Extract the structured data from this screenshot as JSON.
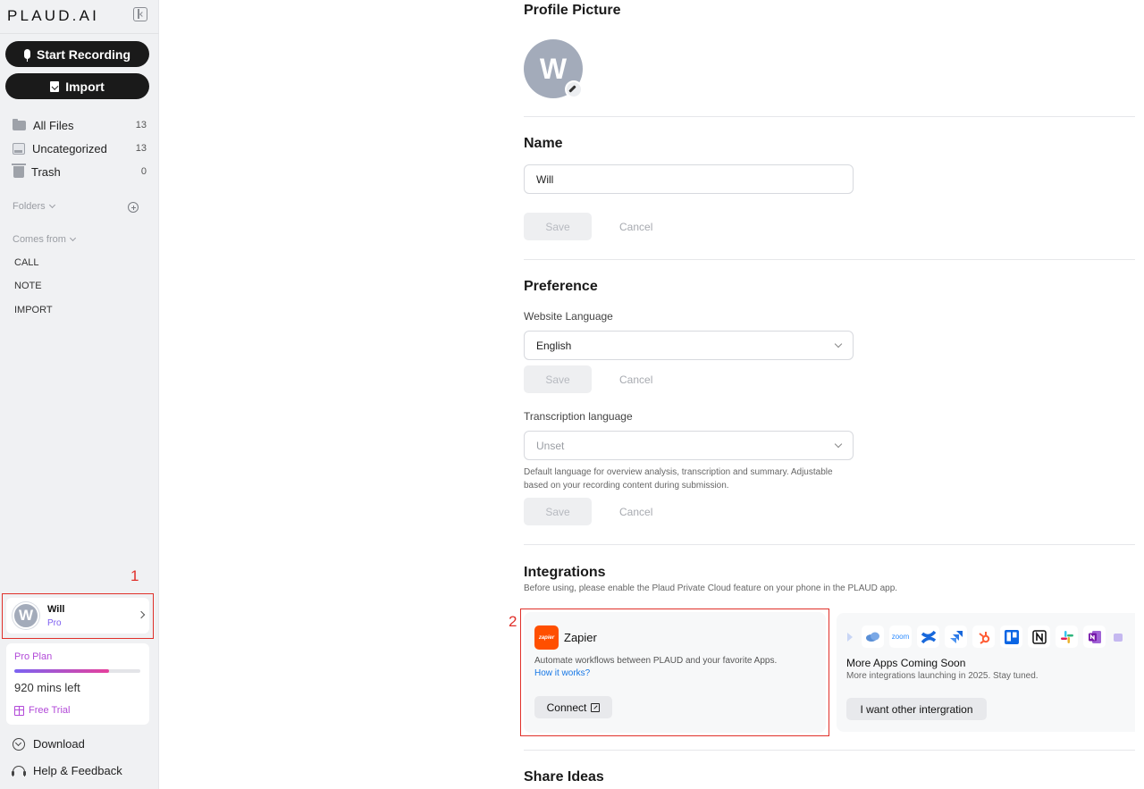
{
  "sidebar": {
    "logo": "PLAUD.AI",
    "start_recording": "Start Recording",
    "import": "Import",
    "nav": [
      {
        "label": "All Files",
        "count": "13"
      },
      {
        "label": "Uncategorized",
        "count": "13"
      },
      {
        "label": "Trash",
        "count": "0"
      }
    ],
    "folders_label": "Folders",
    "comes_from_label": "Comes from",
    "sources": [
      "CALL",
      "NOTE",
      "IMPORT"
    ],
    "user": {
      "initial": "W",
      "name": "Will",
      "plan": "Pro"
    },
    "plan_card": {
      "title": "Pro Plan",
      "usage_fraction": 0.75,
      "mins_left": "920 mins left",
      "trial": "Free Trial"
    },
    "download": "Download",
    "help": "Help & Feedback"
  },
  "annotations": {
    "one": "1",
    "two": "2"
  },
  "main": {
    "profile_picture": {
      "title": "Profile Picture",
      "initial": "W"
    },
    "name_section": {
      "title": "Name",
      "value": "Will",
      "save": "Save",
      "cancel": "Cancel"
    },
    "preference": {
      "title": "Preference",
      "website_language_label": "Website Language",
      "website_language_value": "English",
      "save": "Save",
      "cancel": "Cancel",
      "transcription_label": "Transcription language",
      "transcription_value": "Unset",
      "hint_line1": "Default language for overview analysis, transcription and summary. Adjustable",
      "hint_line2": "based on your recording content during submission."
    },
    "integrations": {
      "title": "Integrations",
      "note": "Before using, please enable the Plaud Private Cloud feature on your phone in the PLAUD app.",
      "zapier": {
        "logo_text": "zapier",
        "title": "Zapier",
        "desc": "Automate workflows between PLAUD and your favorite Apps.",
        "link": "How it works?",
        "connect": "Connect"
      },
      "more": {
        "title": "More Apps Coming Soon",
        "sub": "More integrations launching in 2025. Stay tuned.",
        "button": "I want other intergration",
        "zoom_text": "zoom",
        "app_icons": [
          "cloud-icon",
          "onedrive-icon",
          "zoom-icon",
          "confluence-icon",
          "jira-icon",
          "hubspot-icon",
          "trello-icon",
          "notion-icon",
          "slack-icon",
          "onenote-icon",
          "teams-icon"
        ]
      }
    },
    "share_ideas": {
      "title": "Share Ideas"
    }
  },
  "colors": {
    "accent_red": "#e0302a",
    "zapier_orange": "#ff4f00",
    "plan_purple": "#b24ad8",
    "link_blue": "#1677e6"
  }
}
